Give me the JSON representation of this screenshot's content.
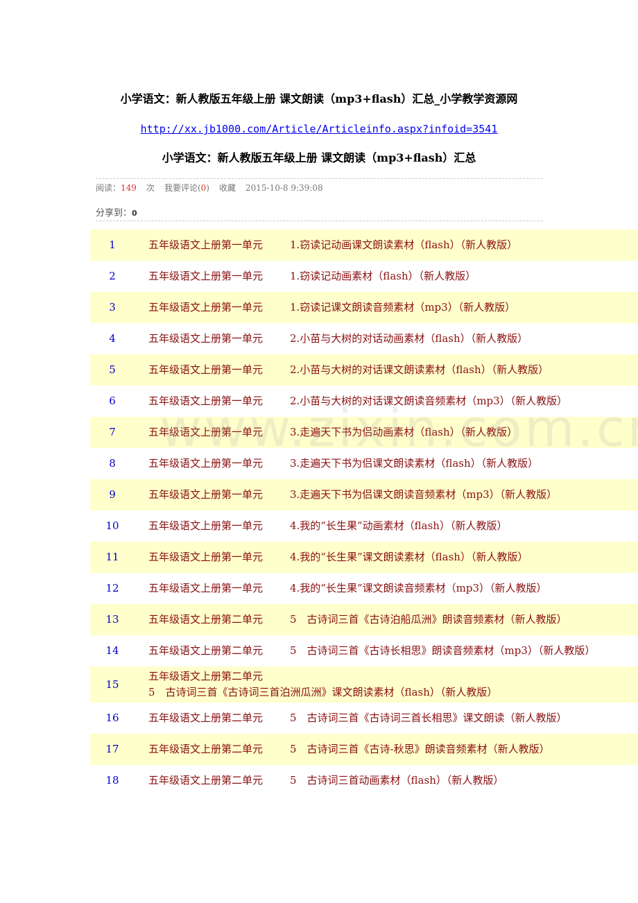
{
  "title": "小学语文：新人教版五年级上册 课文朗读（mp3+flash）汇总_小学教学资源网",
  "url": "http://xx.jb1000.com/Article/Articleinfo.aspx?infoid=3541",
  "subtitle": "小学语文：新人教版五年级上册 课文朗读（mp3+flash）汇总",
  "meta": {
    "read_label": "阅读：",
    "read_count": "149",
    "times_label": "次",
    "comment_label": "我要评论(",
    "comment_count": "0",
    "comment_close": ")",
    "favorite": "收藏",
    "datetime": "2015-10-8 9:39:08"
  },
  "share": {
    "label": "分享到：",
    "count": "0"
  },
  "watermark": "www.zixin.com.cn",
  "items": [
    {
      "num": "1",
      "unit": "五年级语文上册第一单元",
      "title": "1.窃读记动画课文朗读素材（flash）（新人教版）"
    },
    {
      "num": "2",
      "unit": "五年级语文上册第一单元",
      "title": "1.窃读记动画素材（flash）（新人教版）"
    },
    {
      "num": "3",
      "unit": "五年级语文上册第一单元",
      "title": "1.窃读记课文朗读音频素材（mp3）（新人教版）"
    },
    {
      "num": "4",
      "unit": "五年级语文上册第一单元",
      "title": "2.小苗与大树的对话动画素材（flash）（新人教版）"
    },
    {
      "num": "5",
      "unit": "五年级语文上册第一单元",
      "title": "2.小苗与大树的对话课文朗读素材（flash）（新人教版）"
    },
    {
      "num": "6",
      "unit": "五年级语文上册第一单元",
      "title": "2.小苗与大树的对话课文朗读音频素材（mp3）（新人教版）"
    },
    {
      "num": "7",
      "unit": "五年级语文上册第一单元",
      "title": "3.走遍天下书为侣动画素材（flash）（新人教版）"
    },
    {
      "num": "8",
      "unit": "五年级语文上册第一单元",
      "title": "3.走遍天下书为侣课文朗读素材（flash）（新人教版）"
    },
    {
      "num": "9",
      "unit": "五年级语文上册第一单元",
      "title": "3.走遍天下书为侣课文朗读音频素材（mp3）（新人教版）"
    },
    {
      "num": "10",
      "unit": "五年级语文上册第一单元",
      "title": "4.我的“长生果”动画素材（flash）（新人教版）"
    },
    {
      "num": "11",
      "unit": "五年级语文上册第一单元",
      "title": "4.我的“长生果”课文朗读素材（flash）（新人教版）"
    },
    {
      "num": "12",
      "unit": "五年级语文上册第一单元",
      "title": "4.我的“长生果”课文朗读音频素材（mp3）（新人教版）"
    },
    {
      "num": "13",
      "unit": "五年级语文上册第二单元",
      "title": "5　古诗词三首《古诗泊船瓜洲》朗读音频素材（新人教版）"
    },
    {
      "num": "14",
      "unit": "五年级语文上册第二单元",
      "title": "5　古诗词三首《古诗长相思》朗读音频素材（mp3）（新人教版）"
    },
    {
      "num": "15",
      "unit": "五年级语文上册第二单元",
      "title": "5　古诗词三首《古诗词三首泊洲瓜洲》课文朗读素材（flash）（新人教版）"
    },
    {
      "num": "16",
      "unit": "五年级语文上册第二单元",
      "title": "5　古诗词三首《古诗词三首长相思》课文朗读（新人教版）"
    },
    {
      "num": "17",
      "unit": "五年级语文上册第二单元",
      "title": "5　古诗词三首《古诗-秋思》朗读音频素材（新人教版）"
    },
    {
      "num": "18",
      "unit": "五年级语文上册第二单元",
      "title": "5　古诗词三首动画素材（flash）（新人教版）"
    }
  ]
}
